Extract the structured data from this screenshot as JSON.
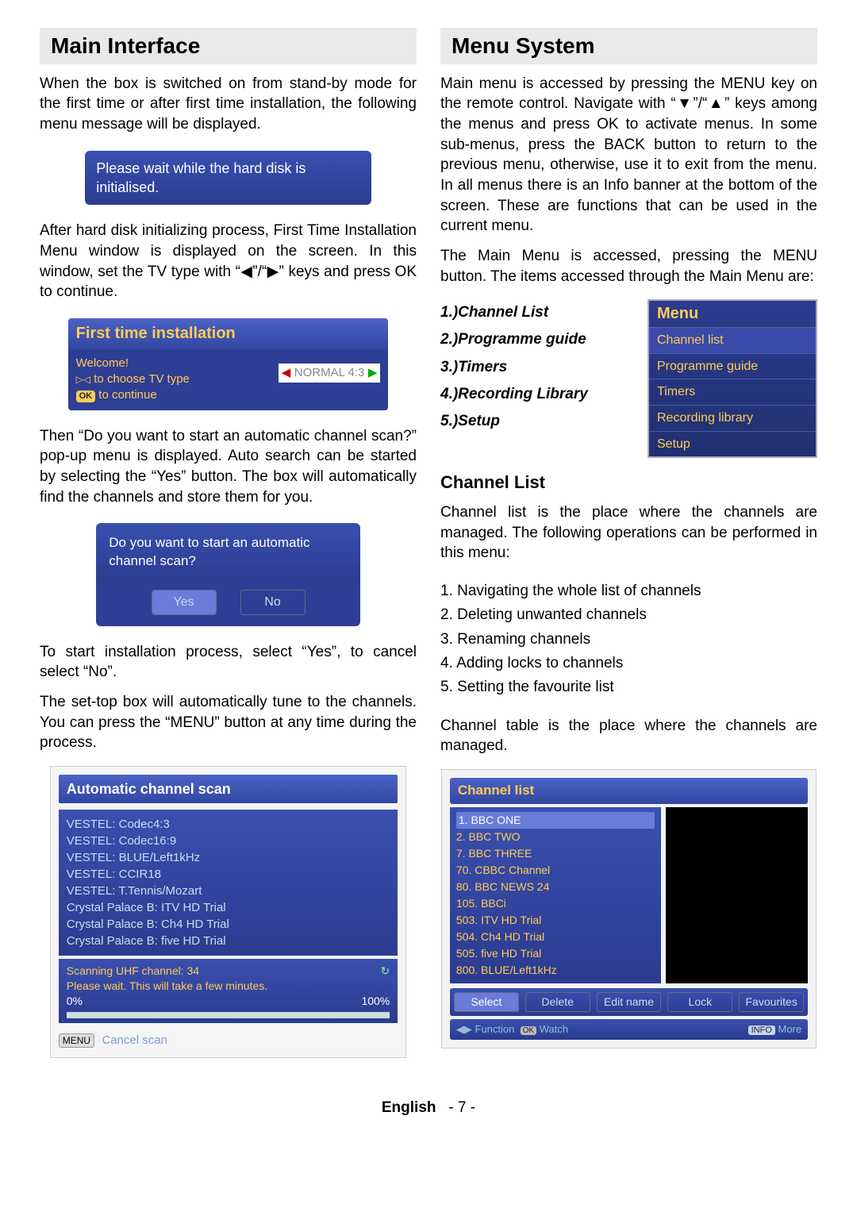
{
  "left": {
    "title": "Main Interface",
    "p1": "When the box is switched on from stand-by mode for the first time or after first time installation, the following menu message will be displayed.",
    "hd_msg": "Please wait while the hard disk is initialised.",
    "p2": "After hard disk initializing process, First Time Installation Menu window is displayed on the screen. In this window, set the TV type with “◀”/“▶” keys and press OK to continue.",
    "first_install": {
      "title": "First time installation",
      "welcome": "Welcome!",
      "line1_badge": "▷◁",
      "line1_rest": " to choose TV type",
      "line2_badge": "OK",
      "line2_rest": " to continue",
      "selector": "NORMAL 4:3"
    },
    "p3": "Then “Do you want to start an automatic channel scan?” pop-up menu is displayed. Auto search can be started by selecting the “Yes” button. The box will automatically find the channels and store them for you.",
    "auto_q": "Do you want to start an automatic channel scan?",
    "yes": "Yes",
    "no": "No",
    "p4": "To start installation process, select “Yes”, to cancel select “No”.",
    "p5": "The set-top box will automatically tune to the channels. You can press the “MENU” button at any time during the process.",
    "scan": {
      "title": "Automatic channel scan",
      "items": [
        "VESTEL: Codec4:3",
        "VESTEL: Codec16:9",
        "VESTEL: BLUE/Left1kHz",
        "VESTEL: CCIR18",
        "VESTEL: T.Tennis/Mozart",
        "Crystal Palace B: ITV HD Trial",
        "Crystal Palace B: Ch4 HD Trial",
        "Crystal Palace B: five HD Trial"
      ],
      "prog1": "Scanning UHF channel: 34",
      "prog2": "Please wait. This will take a few minutes.",
      "pctA": "0%",
      "pctB": "100%",
      "menu_btn": "MENU",
      "cancel_label": "Cancel scan"
    }
  },
  "right": {
    "title": "Menu System",
    "p1": "Main menu is accessed by pressing the MENU key on the remote control. Navigate with “▼”/“▲” keys among the menus and press OK to activate menus. In some sub-menus, press the BACK button to return to the previous menu, otherwise, use it to exit from the menu. In all menus there is an Info banner at the bottom of the screen. These are functions that can be used in the current menu.",
    "p2": "The Main Menu is accessed, pressing the MENU button. The items accessed through the Main Menu are:",
    "menu_items_text": [
      "1.)Channel List",
      "2.)Programme guide",
      "3.)Timers",
      "4.)Recording Library",
      "5.)Setup"
    ],
    "menu_ui": {
      "title": "Menu",
      "items": [
        "Channel list",
        "Programme guide",
        "Timers",
        "Recording  library",
        "Setup"
      ]
    },
    "ch_head": "Channel List",
    "p3": "Channel list  is the place where the channels are managed. The following operations can be performed in this menu:",
    "ops": [
      "1. Navigating the whole list of channels",
      "2. Deleting unwanted channels",
      "3. Renaming channels",
      "4. Adding locks to channels",
      "5. Setting the favourite list"
    ],
    "p4": "Channel table is the place where the channels are managed.",
    "chlist": {
      "title": "Channel list",
      "items": [
        "1. BBC ONE",
        "2. BBC TWO",
        "7. BBC THREE",
        "70. CBBC Channel",
        "80. BBC NEWS 24",
        "105. BBCi",
        "503. ITV HD Trial",
        "504. Ch4 HD Trial",
        "505. five HD Trial",
        "800. BLUE/Left1kHz"
      ],
      "btns": [
        "Select",
        "Delete",
        "Edit name",
        "Lock",
        "Favourites"
      ],
      "help_left_a": "◀▶",
      "help_left_b": "Function",
      "help_left_c": "OK",
      "help_left_d": "Watch",
      "help_right_a": "INFO",
      "help_right_b": "More"
    }
  },
  "footer": {
    "lang": "English",
    "page": "- 7 -"
  }
}
